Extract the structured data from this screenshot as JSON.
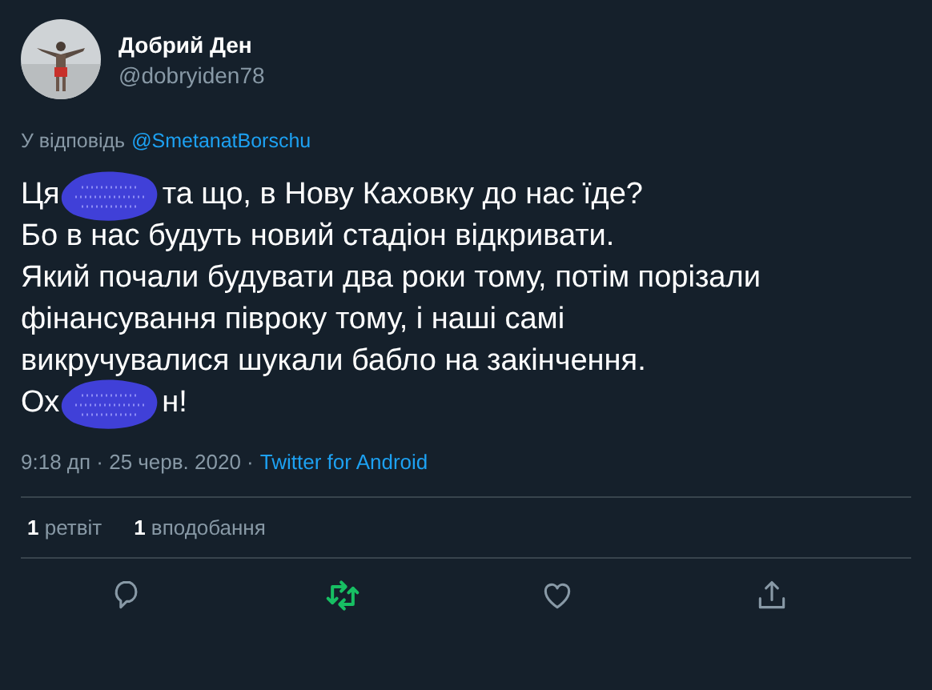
{
  "author": {
    "name": "Добрий Ден",
    "handle": "@dobryiden78"
  },
  "reply_to": {
    "label": "У відповідь",
    "mention": "@SmetanatBorschu"
  },
  "body": [
    [
      {
        "kind": "text",
        "text": "Ця"
      },
      {
        "kind": "redaction"
      },
      {
        "kind": "text",
        "text": "та що, в Нову Каховку до нас їде?"
      }
    ],
    [
      {
        "kind": "text",
        "text": "Бо в нас будуть новий стадіон відкривати."
      }
    ],
    [
      {
        "kind": "text",
        "text": "Який почали будувати два роки тому, потім порізали"
      }
    ],
    [
      {
        "kind": "text",
        "text": "фінансування півроку тому, і наші самі"
      }
    ],
    [
      {
        "kind": "text",
        "text": "викручувалися шукали бабло на закінчення."
      }
    ],
    [
      {
        "kind": "text",
        "text": "Ох"
      },
      {
        "kind": "redaction"
      },
      {
        "kind": "text",
        "text": "н!"
      }
    ]
  ],
  "meta": {
    "time": "9:18 дп · 25 черв. 2020 ·",
    "source": "Twitter for Android"
  },
  "stats": [
    {
      "count": "1",
      "label": "ретвіт"
    },
    {
      "count": "1",
      "label": "вподобання"
    }
  ],
  "actions": [
    {
      "kind": "reply",
      "active": false
    },
    {
      "kind": "retweet",
      "active": true
    },
    {
      "kind": "like",
      "active": false
    },
    {
      "kind": "share",
      "active": false
    }
  ]
}
